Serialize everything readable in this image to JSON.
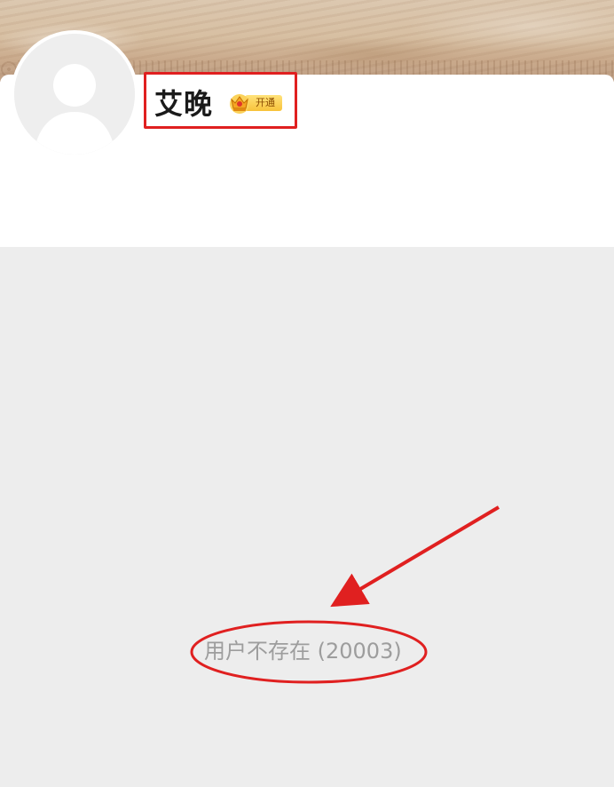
{
  "profile": {
    "username": "艾晚",
    "vip_badge_label": "开通",
    "avatar_icon": "default-user-silhouette"
  },
  "error": {
    "message": "用户不存在 (20003)"
  },
  "colors": {
    "annotation_red": "#e02020",
    "page_background": "#ededed",
    "error_text": "#9d9d9d",
    "vip_gold": "#f8c33b"
  }
}
